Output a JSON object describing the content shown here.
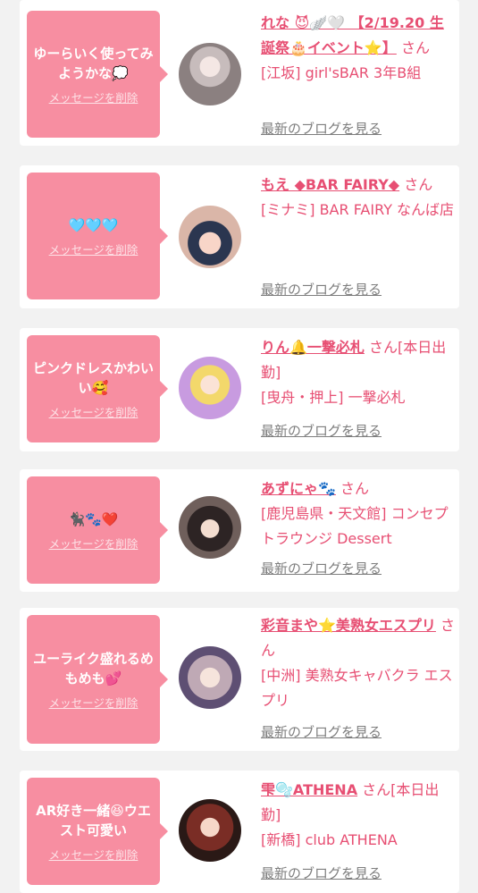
{
  "common": {
    "delete_label": "メッセージを削除",
    "blog_label": "最新のブログを見る"
  },
  "cards": [
    {
      "message": "ゆーらいく使ってみようかな💭",
      "name": "れな 😈🪽🤍 【2/19.20 生誕祭🎂イベント⭐️】",
      "suffix": "さん",
      "store": "[江坂] girl'sBAR 3年B組"
    },
    {
      "message": "🩵🩵🩵",
      "name": "もえ ◆BAR FAIRY◆",
      "suffix": "さん",
      "store": "[ミナミ] BAR FAIRY なんば店"
    },
    {
      "message": "ピンクドレスかわいい🥰",
      "name": "りん🔔一撃必札",
      "suffix": "さん[本日出勤]",
      "store": "[曳舟・押上] 一撃必札"
    },
    {
      "message": "🐈‍⬛🐾❤️",
      "name": "あずにゃ🐾",
      "suffix": "さん",
      "store": "[鹿児島県・天文館] コンセプトラウンジ Dessert"
    },
    {
      "message": "ユーライク盛れるめもめも💕",
      "name": "彩音まや⭐️美熟女エスプリ",
      "suffix": "さん",
      "store": "[中洲] 美熟女キャバクラ エスプリ"
    },
    {
      "message": "AR好き一緒😆ウエスト可愛い",
      "name": "雫🫧ATHENA",
      "suffix": "さん[本日出勤]",
      "store": "[新橋] club ATHENA"
    }
  ],
  "colors": {
    "accent": "#e74f73",
    "bubble": "#f78ea1",
    "background": "#f2f2f2"
  }
}
